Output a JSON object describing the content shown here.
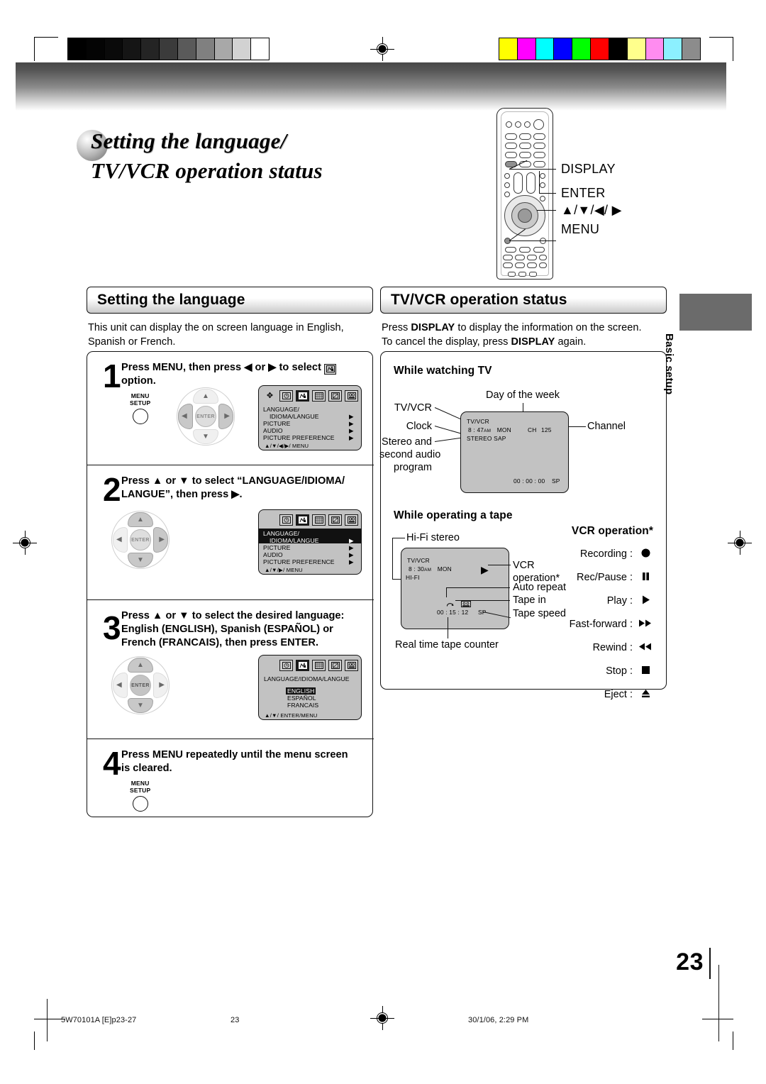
{
  "page": {
    "title_line1": "Setting the language/",
    "title_line2": "TV/VCR operation status",
    "number": "23",
    "side_tab": "Basic setup"
  },
  "footer": {
    "doc_code": "5W70101A [E]p23-27",
    "page": "23",
    "timestamp": "30/1/06, 2:29 PM"
  },
  "remote": {
    "callouts": [
      {
        "label": "DISPLAY"
      },
      {
        "label": "ENTER"
      },
      {
        "label": "▲/▼/◀/ ▶"
      },
      {
        "label": "MENU"
      }
    ]
  },
  "left": {
    "heading": "Setting the language",
    "intro_line1": "This unit can display the on screen language in English,",
    "intro_line2": "Spanish or French.",
    "steps": [
      {
        "number": "1",
        "text_line1": "Press MENU, then press ◀ or ▶ to select",
        "text_line2": "option.",
        "button_cap1": "MENU",
        "button_cap2": "SETUP"
      },
      {
        "number": "2",
        "text_line1": "Press ▲ or ▼ to select “LANGUAGE/IDIOMA/",
        "text_line2": "LANGUE”, then press ▶."
      },
      {
        "number": "3",
        "text_line1": "Press ▲ or ▼ to select the desired language:",
        "text_line2": "English (ENGLISH), Spanish (ESPAÑOL) or",
        "text_line3": "French (FRANCAIS), then press ENTER."
      },
      {
        "number": "4",
        "text_line1": "Press MENU repeatedly until the menu screen",
        "text_line2": "is cleared.",
        "button_cap1": "MENU",
        "button_cap2": "SETUP"
      }
    ],
    "osd1": {
      "icons": [
        "clock-icon",
        "language-icon",
        "calendar-icon",
        "blank-icon",
        "tape-icon"
      ],
      "selected_icon_index": 1,
      "rows": [
        {
          "label_line1": "LANGUAGE/",
          "label_line2": "IDIOMA/LANGUE",
          "arrow": "▶"
        },
        {
          "label_line1": "PICTURE",
          "arrow": "▶"
        },
        {
          "label_line1": "AUDIO",
          "arrow": "▶"
        },
        {
          "label_line1": "PICTURE  PREFERENCE",
          "arrow": "▶"
        }
      ],
      "footer": "▲/▼/◀/▶/ MENU"
    },
    "osd2": {
      "icons": [
        "clock-icon",
        "language-icon",
        "calendar-icon",
        "blank-icon",
        "tape-icon"
      ],
      "selected_icon_index": 1,
      "rows": [
        {
          "label_line1": "LANGUAGE/",
          "label_line2": "IDIOMA/LANGUE",
          "arrow": "▶",
          "highlighted": true
        },
        {
          "label_line1": "PICTURE",
          "arrow": "▶"
        },
        {
          "label_line1": "AUDIO",
          "arrow": "▶"
        },
        {
          "label_line1": "PICTURE  PREFERENCE",
          "arrow": "▶"
        }
      ],
      "footer": "▲/▼/▶/ MENU"
    },
    "osd3": {
      "icons": [
        "clock-icon",
        "language-icon",
        "calendar-icon",
        "blank-icon",
        "tape-icon"
      ],
      "selected_icon_index": 1,
      "title": "LANGUAGE/IDIOMA/LANGUE",
      "options": [
        "ENGLISH",
        "ESPAÑOL",
        "FRANCAIS"
      ],
      "selected_option": "ENGLISH",
      "footer": "▲/▼/ ENTER/MENU"
    }
  },
  "right": {
    "heading": "TV/VCR operation status",
    "intro_line1_a": "Press ",
    "intro_line1_b": "DISPLAY",
    "intro_line1_c": " to display the information on the screen.",
    "intro_line2_a": "To cancel the display, press ",
    "intro_line2_b": "DISPLAY",
    "intro_line2_c": " again.",
    "watching_tv": {
      "heading": "While watching TV",
      "annotations": {
        "day_of_week": "Day of the week",
        "tv_vcr": "TV/VCR",
        "clock": "Clock",
        "stereo_l1": "Stereo and",
        "stereo_l2": "second audio",
        "stereo_l3": "program",
        "channel": "Channel"
      },
      "screen": {
        "mode": "TV/VCR",
        "time": "8 : 47",
        "time_ampm": "AM",
        "day": "MON",
        "audio": "STEREO  SAP",
        "channel_label": "CH",
        "channel_number": "125",
        "counter": "00 : 00 : 00",
        "speed": "SP"
      }
    },
    "operating_tape": {
      "heading": "While operating a tape",
      "annotations": {
        "hifi": "Hi-Fi stereo",
        "vcr_op_l1": "VCR",
        "vcr_op_l2": "operation*",
        "auto_repeat": "Auto repeat",
        "tape_in": "Tape in",
        "tape_speed": "Tape speed",
        "counter": "Real time tape counter"
      },
      "screen": {
        "mode": "TV/VCR",
        "time": "8 : 30",
        "time_ampm": "AM",
        "day": "MON",
        "audio": "HI-FI",
        "op_symbol": "▶",
        "counter": "00 : 15 : 12",
        "speed": "SP"
      }
    },
    "vcr_operation": {
      "heading": "VCR operation*",
      "items": [
        {
          "label": "Recording :",
          "symbol": "●",
          "icon": "record-icon"
        },
        {
          "label": "Rec/Pause :",
          "symbol": "▐▐",
          "icon": "pause-icon"
        },
        {
          "label": "Play :",
          "symbol": "▶",
          "icon": "play-icon"
        },
        {
          "label": "Fast-forward :",
          "symbol": "▶▶",
          "icon": "fast-forward-icon"
        },
        {
          "label": "Rewind :",
          "symbol": "◀◀",
          "icon": "rewind-icon"
        },
        {
          "label": "Stop :",
          "symbol": "■",
          "icon": "stop-icon"
        },
        {
          "label": "Eject :",
          "symbol": "▲",
          "icon": "eject-icon"
        }
      ]
    }
  },
  "colors": {
    "gray_bar": [
      "#000000",
      "#040404",
      "#0a0a0a",
      "#151515",
      "#242424",
      "#3b3b3b",
      "#5a5a5a",
      "#808080",
      "#a8a8a8",
      "#d2d2d2",
      "#ffffff"
    ],
    "color_bar": [
      "#ffff00",
      "#ff00ff",
      "#00ffff",
      "#0000ff",
      "#00ff00",
      "#ff0000",
      "#000000",
      "#ffff8c",
      "#ff8cf0",
      "#8cf0ff",
      "#8c8c8c"
    ],
    "tab": "#6b6b6b",
    "osd_bg": "#c2c2c2"
  }
}
